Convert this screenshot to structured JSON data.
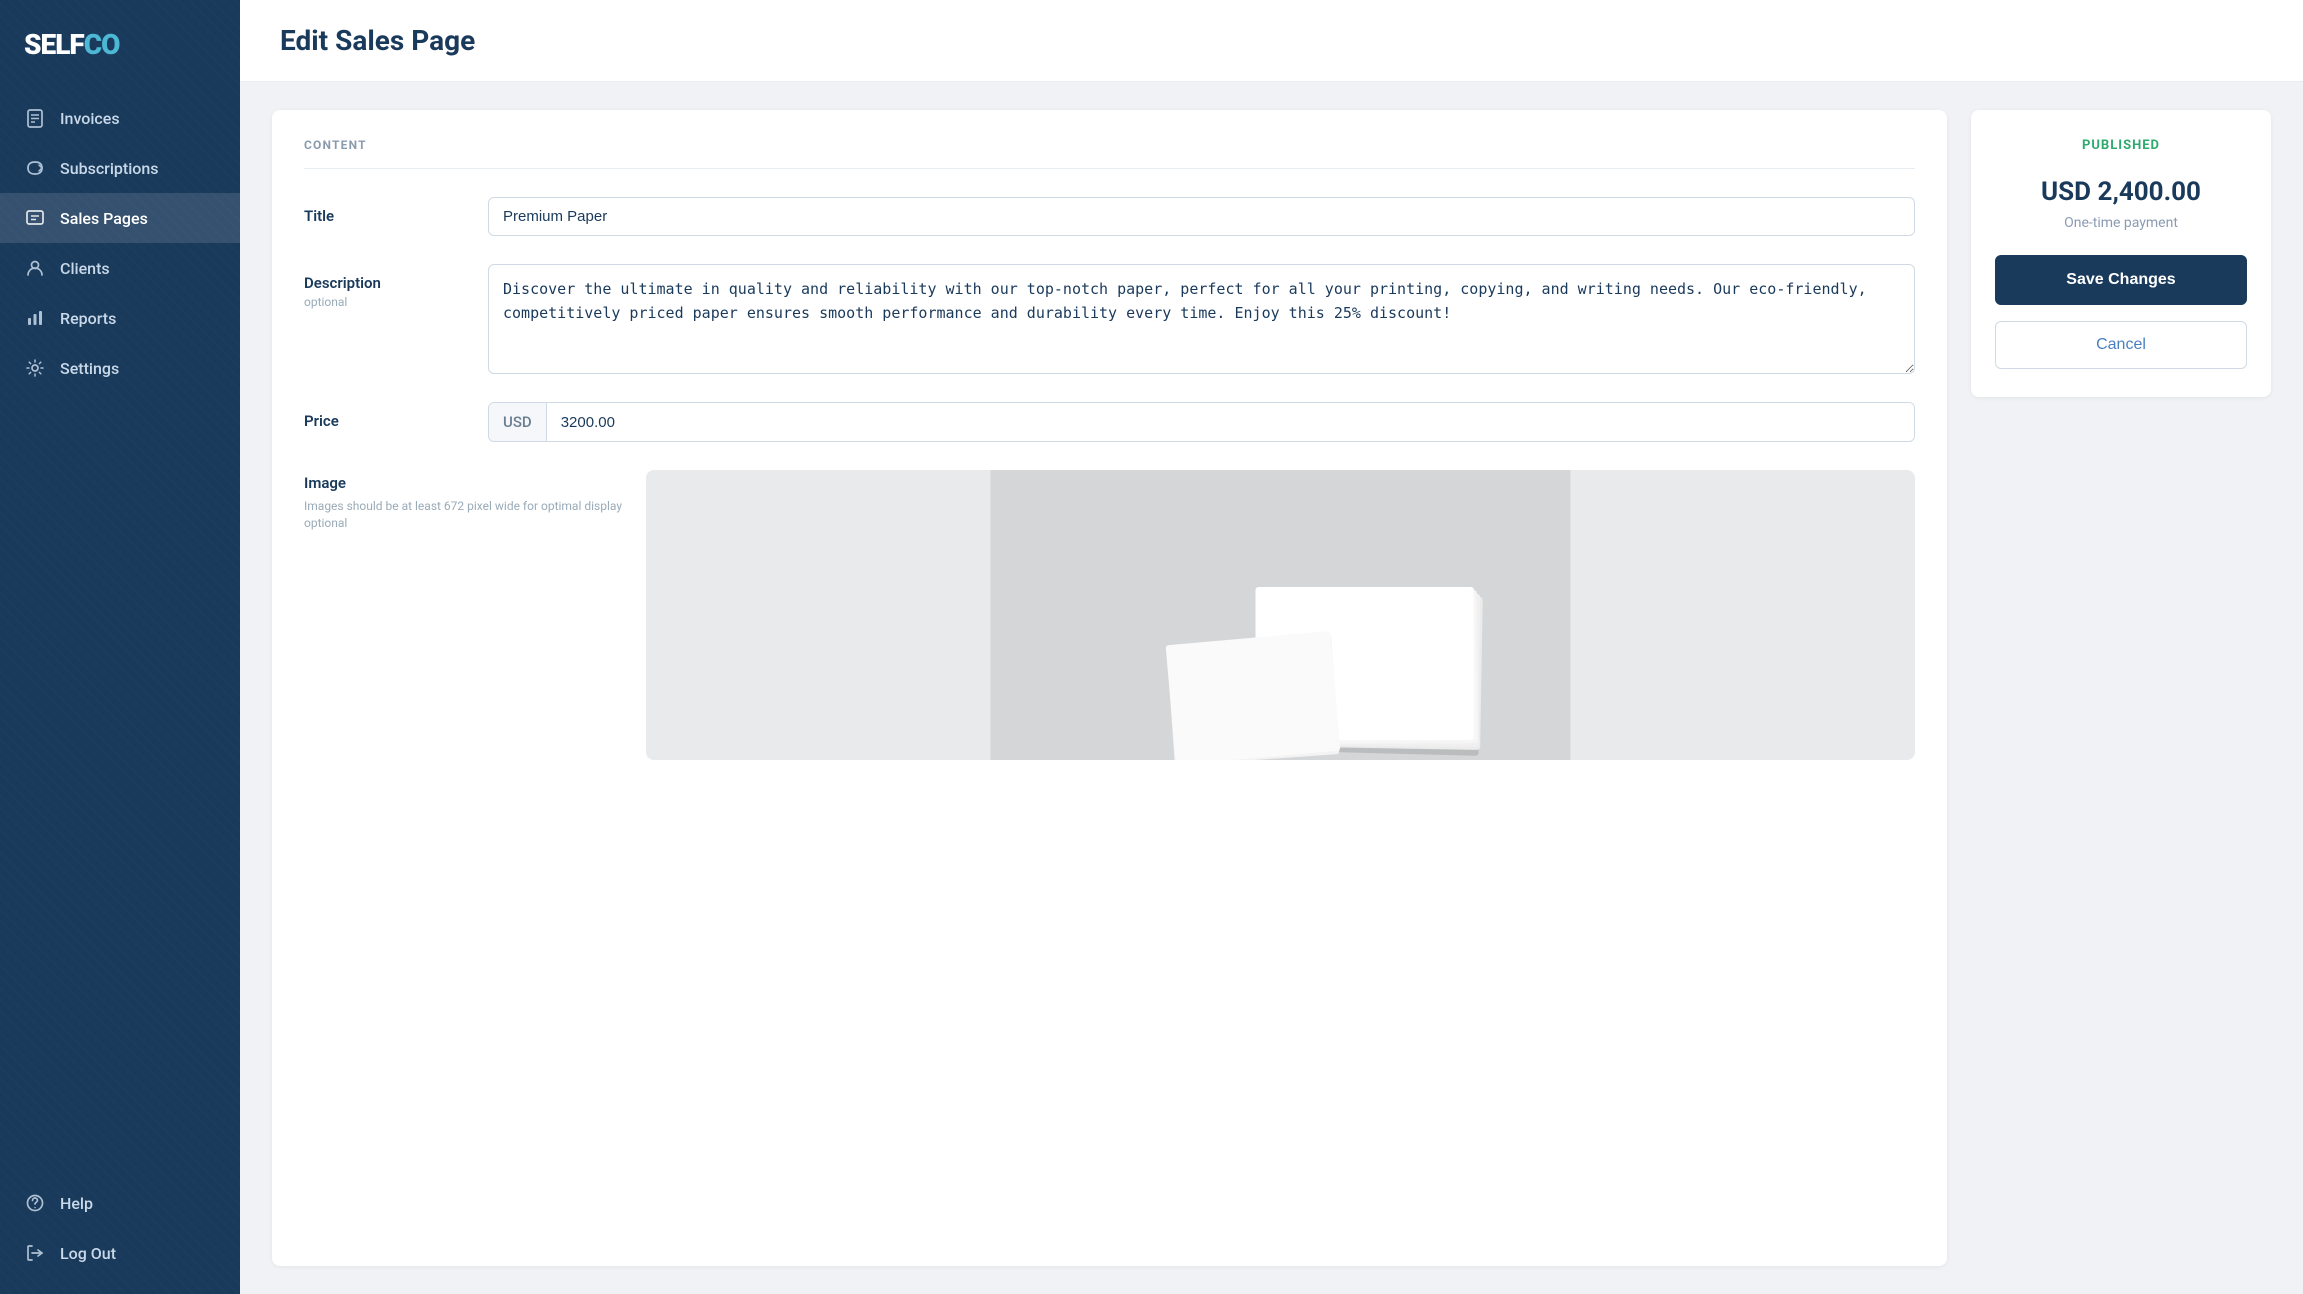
{
  "app": {
    "logo": "SELFCO",
    "logo_accent": "CO"
  },
  "sidebar": {
    "items": [
      {
        "id": "invoices",
        "label": "Invoices",
        "icon": "invoice-icon"
      },
      {
        "id": "subscriptions",
        "label": "Subscriptions",
        "icon": "subscriptions-icon"
      },
      {
        "id": "sales-pages",
        "label": "Sales Pages",
        "icon": "sales-pages-icon",
        "active": true
      },
      {
        "id": "clients",
        "label": "Clients",
        "icon": "clients-icon"
      },
      {
        "id": "reports",
        "label": "Reports",
        "icon": "reports-icon"
      },
      {
        "id": "settings",
        "label": "Settings",
        "icon": "settings-icon"
      }
    ],
    "bottom_items": [
      {
        "id": "help",
        "label": "Help",
        "icon": "help-icon"
      },
      {
        "id": "logout",
        "label": "Log Out",
        "icon": "logout-icon"
      }
    ]
  },
  "page": {
    "title": "Edit Sales Page"
  },
  "form": {
    "section_label": "CONTENT",
    "title_label": "Title",
    "title_value": "Premium Paper",
    "description_label": "Description",
    "description_optional": "optional",
    "description_value": "Discover the ultimate in quality and reliability with our top-notch paper, perfect for all your printing, copying, and writing needs. Our eco-friendly, competitively priced paper ensures smooth performance and durability every time. Enjoy this 25% discount!",
    "price_label": "Price",
    "price_currency": "USD",
    "price_value": "3200.00",
    "image_label": "Image",
    "image_hint_1": "Images should be at least 672 pixel wide for optimal display",
    "image_hint_2": "optional"
  },
  "sidebar_panel": {
    "status": "PUBLISHED",
    "price_display": "USD 2,400.00",
    "payment_type": "One-time payment",
    "save_button": "Save Changes",
    "cancel_button": "Cancel"
  }
}
